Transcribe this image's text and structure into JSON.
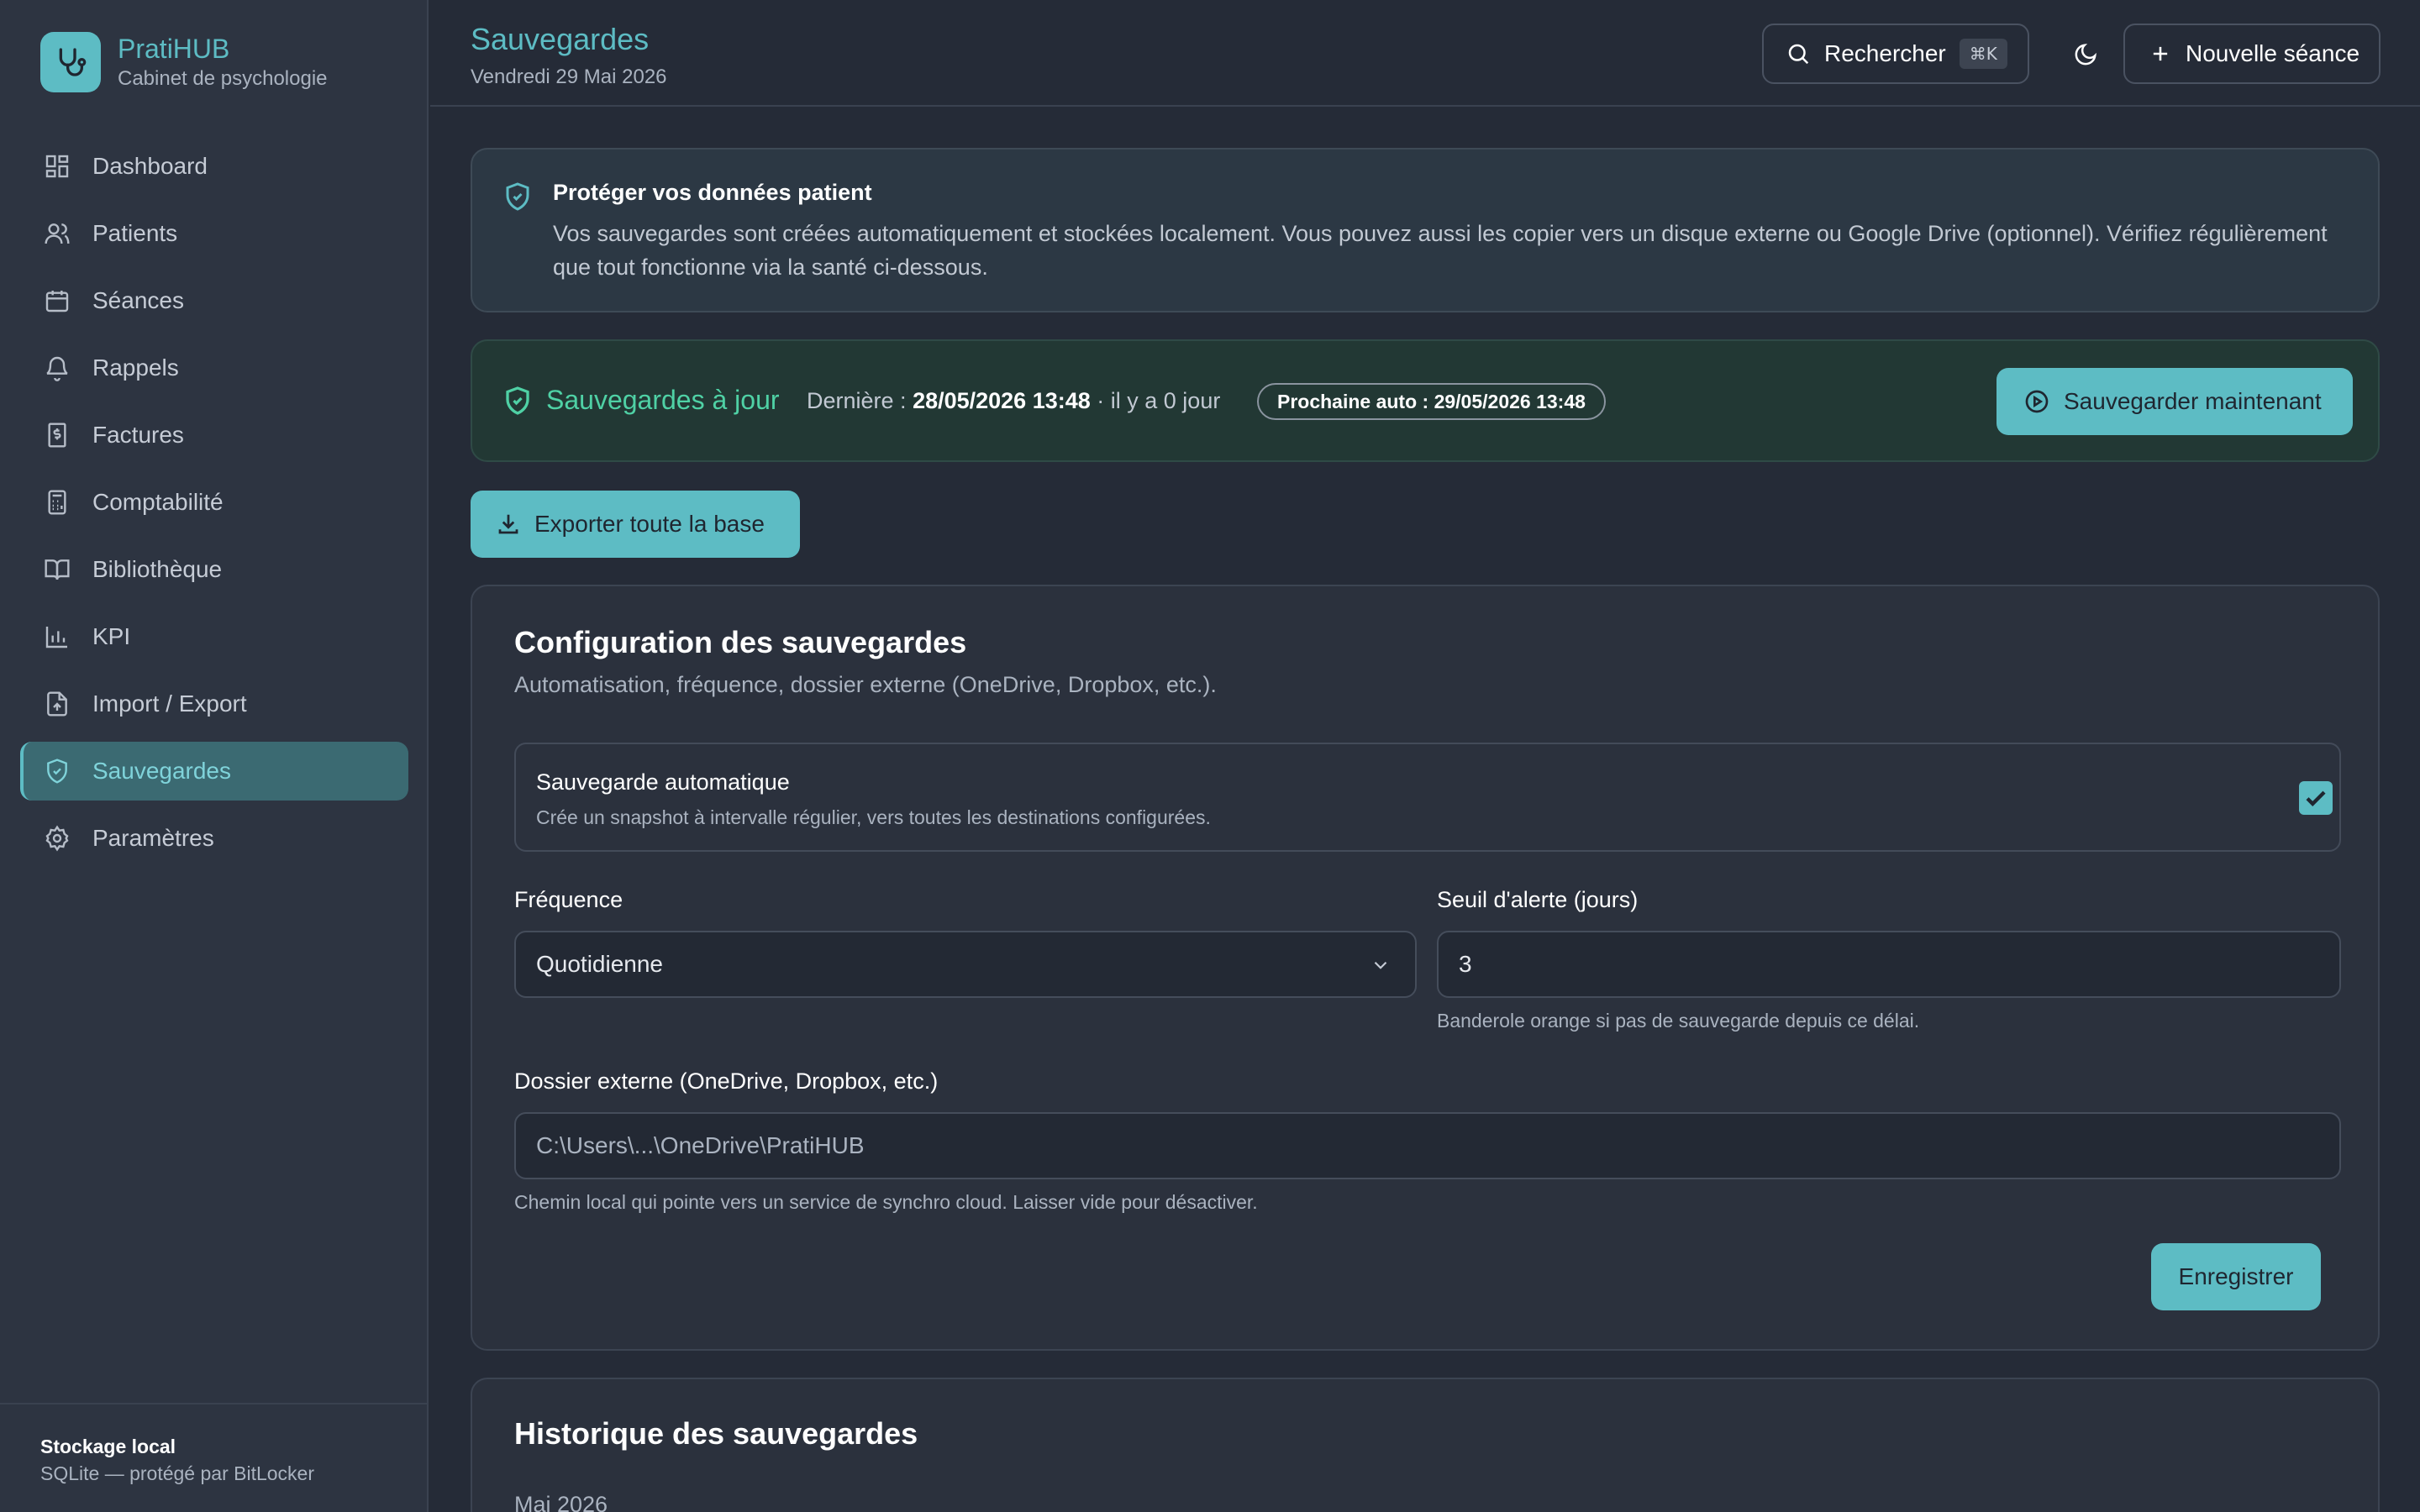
{
  "app": {
    "name": "PratiHUB",
    "subtitle": "Cabinet de psychologie"
  },
  "sidebar": {
    "items": [
      {
        "label": "Dashboard",
        "icon": "dashboard-grid-icon"
      },
      {
        "label": "Patients",
        "icon": "users-icon"
      },
      {
        "label": "Séances",
        "icon": "calendar-icon"
      },
      {
        "label": "Rappels",
        "icon": "bell-icon"
      },
      {
        "label": "Factures",
        "icon": "invoice-icon"
      },
      {
        "label": "Comptabilité",
        "icon": "calculator-icon"
      },
      {
        "label": "Bibliothèque",
        "icon": "book-icon"
      },
      {
        "label": "KPI",
        "icon": "bar-chart-icon"
      },
      {
        "label": "Import / Export",
        "icon": "file-upload-icon"
      },
      {
        "label": "Sauvegardes",
        "icon": "shield-check-icon",
        "active": true
      },
      {
        "label": "Paramètres",
        "icon": "gear-icon"
      }
    ],
    "footer": {
      "title": "Stockage local",
      "subtitle": "SQLite — protégé par BitLocker"
    }
  },
  "header": {
    "title": "Sauvegardes",
    "date": "Vendredi 29 Mai 2026",
    "search_label": "Rechercher",
    "search_shortcut": "⌘K",
    "new_session_label": "Nouvelle séance"
  },
  "info": {
    "title": "Protéger vos données patient",
    "text": "Vos sauvegardes sont créées automatiquement et stockées localement. Vous pouvez aussi les copier vers un disque externe ou Google Drive (optionnel). Vérifiez régulièrement que tout fonctionne via la santé ci-dessous."
  },
  "status": {
    "ok_label": "Sauvegardes à jour",
    "last_prefix": "Dernière :",
    "last_value": "28/05/2026 13:48",
    "last_suffix": "· il y a 0 jour",
    "next_label": "Prochaine auto : 29/05/2026 13:48",
    "save_now_label": "Sauvegarder maintenant"
  },
  "export_label": "Exporter toute la base",
  "config": {
    "title": "Configuration des sauvegardes",
    "subtitle": "Automatisation, fréquence, dossier externe (OneDrive, Dropbox, etc.).",
    "auto": {
      "title": "Sauvegarde automatique",
      "description": "Crée un snapshot à intervalle régulier, vers toutes les destinations configurées.",
      "checked": true
    },
    "frequency": {
      "label": "Fréquence",
      "value": "Quotidienne"
    },
    "threshold": {
      "label": "Seuil d'alerte (jours)",
      "value": "3",
      "hint": "Banderole orange si pas de sauvegarde depuis ce délai."
    },
    "folder": {
      "label": "Dossier externe (OneDrive, Dropbox, etc.)",
      "placeholder": "C:\\Users\\...\\OneDrive\\PratiHUB",
      "hint": "Chemin local qui pointe vers un service de synchro cloud. Laisser vide pour désactiver."
    },
    "save_label": "Enregistrer"
  },
  "history": {
    "title": "Historique des sauvegardes",
    "month": "Mai 2026"
  },
  "colors": {
    "accent": "#5dbcc4",
    "success": "#4fd1a5",
    "background": "#252b37",
    "sidebar": "#2d3441"
  }
}
